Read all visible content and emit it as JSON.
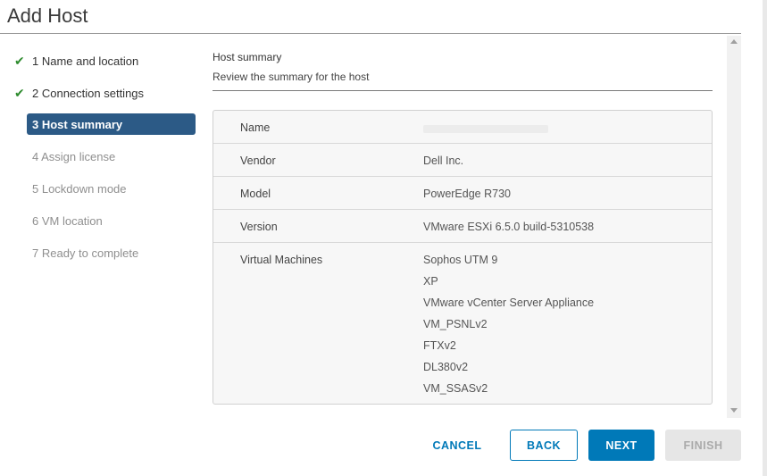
{
  "dialog": {
    "title": "Add Host"
  },
  "steps": [
    {
      "label": "1 Name and location",
      "state": "done"
    },
    {
      "label": "2 Connection settings",
      "state": "done"
    },
    {
      "label": "3 Host summary",
      "state": "active"
    },
    {
      "label": "4 Assign license",
      "state": "pending"
    },
    {
      "label": "5 Lockdown mode",
      "state": "pending"
    },
    {
      "label": "6 VM location",
      "state": "pending"
    },
    {
      "label": "7 Ready to complete",
      "state": "pending"
    }
  ],
  "section": {
    "title": "Host summary",
    "subtitle": "Review the summary for the host"
  },
  "summary": {
    "name_label": "Name",
    "vendor_label": "Vendor",
    "vendor": "Dell Inc.",
    "model_label": "Model",
    "model": "PowerEdge R730",
    "version_label": "Version",
    "version": "VMware ESXi 6.5.0 build-5310538",
    "vms_label": "Virtual Machines",
    "vms": [
      "Sophos UTM 9",
      "XP",
      "VMware vCenter Server Appliance",
      "VM_PSNLv2",
      "FTXv2",
      "DL380v2",
      "VM_SSASv2"
    ]
  },
  "buttons": {
    "cancel": "CANCEL",
    "back": "BACK",
    "next": "NEXT",
    "finish": "FINISH"
  },
  "icons": {
    "check": "checkmark-icon"
  },
  "colors": {
    "accent": "#0079b8",
    "active_step": "#2c5a86",
    "check": "#2e8b2e"
  }
}
